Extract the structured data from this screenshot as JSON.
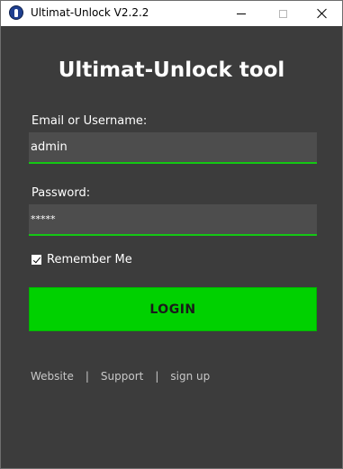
{
  "window": {
    "title": "Ultimat-Unlock V2.2.2"
  },
  "heading": "Ultimat-Unlock tool",
  "form": {
    "email_label": "Email or Username:",
    "email_value": "admin",
    "password_label": "Password:",
    "password_value": "*****",
    "remember_label": "Remember Me",
    "remember_checked": true,
    "login_label": "LOGIN"
  },
  "links": {
    "website": "Website",
    "support": "Support",
    "signup": "sign up",
    "separator": "|"
  },
  "colors": {
    "background": "#3c3c3c",
    "field_background": "#4d4d4d",
    "accent_green": "#00d100",
    "field_underline": "#14c814"
  },
  "icons": {
    "app": "unlock-logo-icon",
    "minimize": "minimize-icon",
    "maximize": "maximize-icon",
    "close": "close-icon",
    "checkbox": "checkmark-icon"
  }
}
